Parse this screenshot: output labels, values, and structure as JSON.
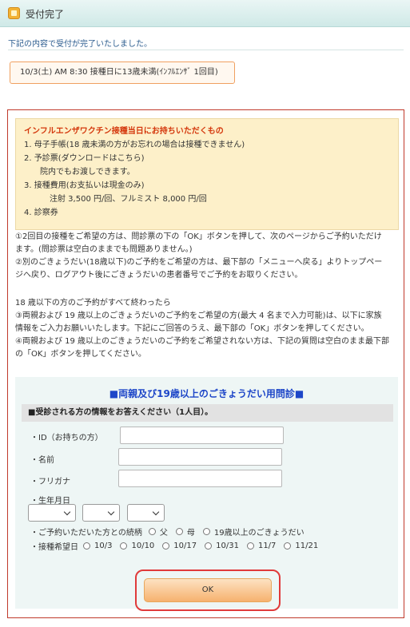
{
  "header": {
    "title": "受付完了",
    "icon": "box-icon"
  },
  "done_message": "下記の内容で受付が完了いたしました。",
  "appointment": "10/3(土) AM 8:30 接種日に13歳未満(ｲﾝﾌﾙｴﾝｻﾞ 1回目)",
  "notice": {
    "title": "インフルエンザワクチン接種当日にお持ちいただくもの",
    "items": [
      "1. 母子手帳(18 歳未満の方がお忘れの場合は接種できません)",
      "2. 予診票(ダウンロードはこちら)",
      "院内でもお渡しできます。",
      "3. 接種費用(お支払いは現金のみ)",
      "注射 3,500 円/回、フルミスト 8,000 円/回",
      "4. 診察券"
    ]
  },
  "paragraphs": {
    "p1a": "①2回目の接種をご希望の方は、問診票の下の「OK」ボタンを押して、次のページからご予約いただけ",
    "p1b": "ます。(問診票は空白のままでも問題ありません。)",
    "p2a": "②別のごきょうだい(18歳以下)のご予約をご希望の方は、最下部の「メニューへ戻る」よりトップペー",
    "p2b": "ジへ戻り、ログアウト後にごきょうだいの患者番号でご予約をお取りください。",
    "p3": "18 歳以下の方のご予約がすべて終わったら",
    "p4a": "③両親および 19 歳以上のごきょうだいのご予約をご希望の方(最大 4 名まで入力可能)は、以下に家族",
    "p4b": "情報をご入力お願いいたします。下記にご回答のうえ、最下部の「OK」ボタンを押してください。",
    "p5a": "④両親および 19 歳以上のごきょうだいのご予約をご希望されない方は、下記の質問は空白のまま最下部",
    "p5b": "の「OK」ボタンを押してください。"
  },
  "survey": {
    "title": "■両親及び19歳以上のごきょうだい用問診■",
    "subtitle": "■受診される方の情報をお答えください（1人目）。",
    "id_label": "・ID（お持ちの方）",
    "name_label": "・名前",
    "kana_label": "・フリガナ",
    "birth_label": "・生年月日",
    "birth_selects": [
      "",
      "",
      ""
    ],
    "relation_label": "・ご予約いただいた方との続柄",
    "relation_options": [
      "父",
      "母",
      "19歳以上のごきょうだい"
    ],
    "date_label": "・接種希望日",
    "date_options": [
      "10/3",
      "10/10",
      "10/17",
      "10/31",
      "11/7",
      "11/21"
    ]
  },
  "ok_label": "OK"
}
